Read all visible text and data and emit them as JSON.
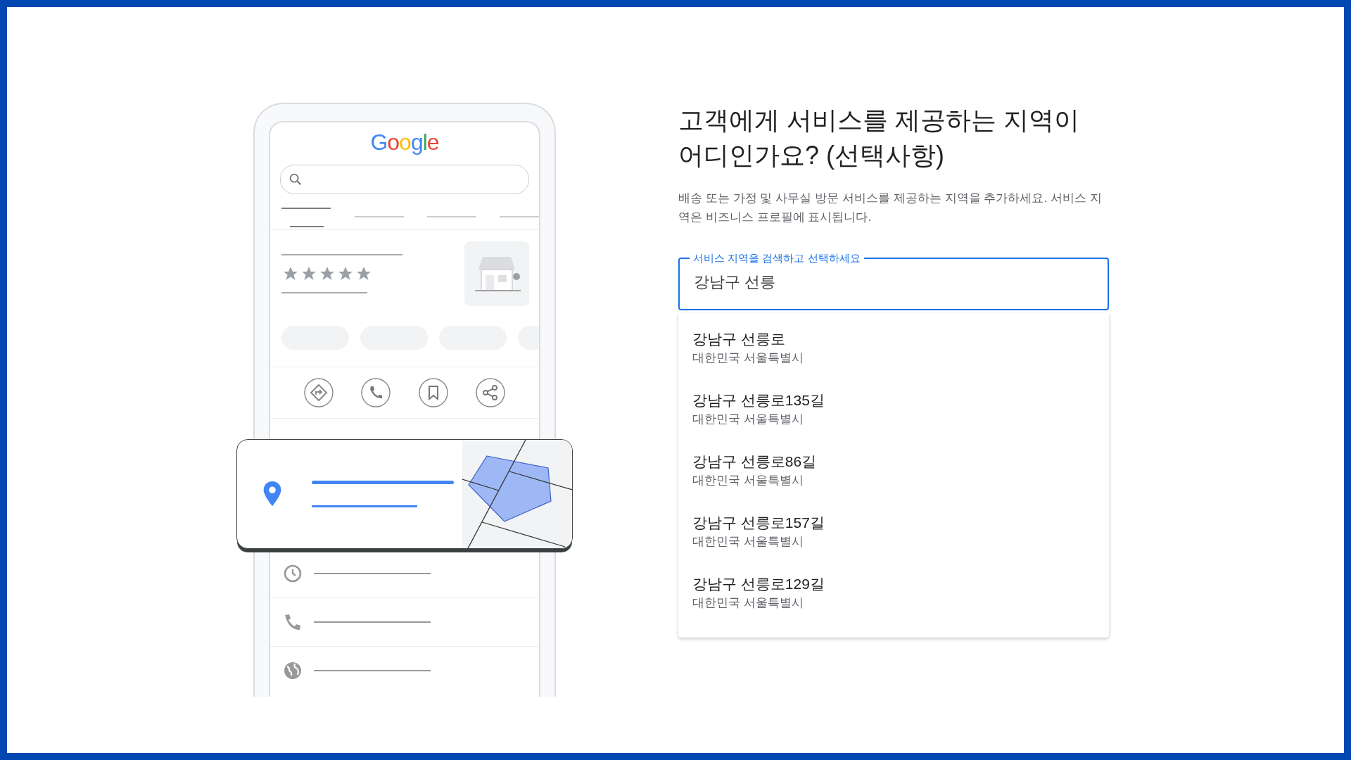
{
  "illustration": {
    "logo": "Google",
    "rating": {
      "stars": 5
    }
  },
  "heading": "고객에게 서비스를 제공하는 지역이 어디인가요? (선택사항)",
  "description": "배송 또는 가정 및 사무실 방문 서비스를 제공하는 지역을 추가하세요. 서비스 지역은 비즈니스 프로필에 표시됩니다.",
  "search": {
    "label": "서비스 지역을 검색하고 선택하세요",
    "value": "강남구 선릉"
  },
  "suggestions": [
    {
      "name": "강남구 선릉로",
      "region": "대한민국 서울특별시"
    },
    {
      "name": "강남구 선릉로135길",
      "region": "대한민국 서울특별시"
    },
    {
      "name": "강남구 선릉로86길",
      "region": "대한민국 서울특별시"
    },
    {
      "name": "강남구 선릉로157길",
      "region": "대한민국 서울특별시"
    },
    {
      "name": "강남구 선릉로129길",
      "region": "대한민국 서울특별시"
    }
  ]
}
